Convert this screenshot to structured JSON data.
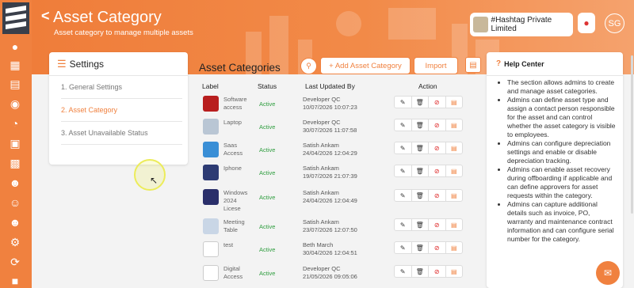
{
  "header": {
    "back": "<",
    "title": "Asset Category",
    "subtitle": "Asset category to manage multiple assets",
    "company": "#Hashtag Private Limited",
    "avatar": "SG"
  },
  "sidebar": {
    "icons": [
      "logo-icon",
      "network-icon",
      "dashboard-icon",
      "document-icon",
      "hand-money-icon",
      "speed-icon",
      "id-card-icon",
      "employee-card-icon",
      "user-settings-icon",
      "team-icon",
      "people-icon",
      "group-icon",
      "gear-cycle-icon",
      "cycle-icon",
      "building-icon"
    ]
  },
  "settings": {
    "heading": "Settings",
    "items": [
      {
        "label": "1. General Settings"
      },
      {
        "label": "2. Asset Category"
      },
      {
        "label": "3. Asset Unavailable Status"
      }
    ]
  },
  "toolbar": {
    "section_title": "Asset Categories",
    "add_label": "+ Add Asset Category",
    "import_label": "Import"
  },
  "table": {
    "headers": {
      "label": "Label",
      "status": "Status",
      "updated": "Last Updated By",
      "action": "Action"
    },
    "rows": [
      {
        "label": "Software access",
        "status": "Active",
        "by": "Developer QC",
        "date": "10/07/2026 10:07:23",
        "thumb": "#b81e1e"
      },
      {
        "label": "Laptop",
        "status": "Active",
        "by": "Developer QC",
        "date": "30/07/2026 11:07:58",
        "thumb": "#b9c6d4"
      },
      {
        "label": "Saas Access",
        "status": "Active",
        "by": "Satish Ankam",
        "date": "24/04/2026 12:04:29",
        "thumb": "#3a8fd6"
      },
      {
        "label": "Iphone",
        "status": "Active",
        "by": "Satish Ankam",
        "date": "19/07/2026 21:07:39",
        "thumb": "#2d3b73"
      },
      {
        "label": "Windows 2024 Licese",
        "status": "Active",
        "by": "Satish Ankam",
        "date": "24/04/2026 12:04:49",
        "thumb": "#2a2f6a"
      },
      {
        "label": "Meeting Table",
        "status": "Active",
        "by": "Satish Ankam",
        "date": "23/07/2026 12:07:50",
        "thumb": "#c9d6e6"
      },
      {
        "label": "test",
        "status": "Active",
        "by": "Beth March",
        "date": "30/04/2026 12:04:51",
        "thumb": "#ffffff"
      },
      {
        "label": "Digital Access",
        "status": "Active",
        "by": "Developer QC",
        "date": "21/05/2026 09:05:06",
        "thumb": "#ffffff"
      }
    ]
  },
  "help": {
    "heading": "Help Center",
    "items": [
      "The section allows admins to create and manage asset categories.",
      "Admins can define asset type and assign a contact person responsible for the asset and can control whether the asset category is visible to employees.",
      "Admins can configure depreciation settings and enable or disable depreciation tracking.",
      "Admins can enable asset recovery during offboarding if applicable and can define approvers for asset requests within the category.",
      "Admins can capture additional details such as invoice, PO, warranty and maintenance contract information and can configure serial number for the category."
    ]
  },
  "colors": {
    "accent": "#f0813f",
    "active": "#2e9d3e"
  }
}
